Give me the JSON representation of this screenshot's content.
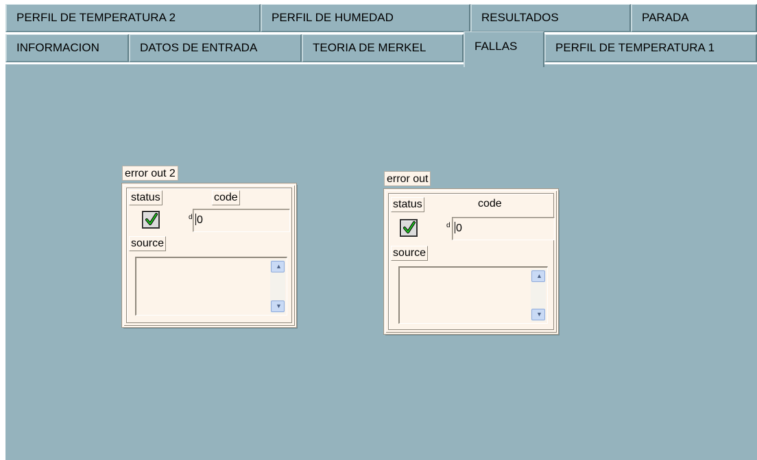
{
  "tabs": {
    "row1": [
      {
        "label": "PERFIL DE TEMPERATURA 2"
      },
      {
        "label": "PERFIL DE HUMEDAD"
      },
      {
        "label": "RESULTADOS"
      },
      {
        "label": "PARADA"
      }
    ],
    "row2": [
      {
        "label": "INFORMACION"
      },
      {
        "label": "DATOS DE ENTRADA"
      },
      {
        "label": "TEORIA DE MERKEL"
      },
      {
        "label": "FALLAS",
        "active": true
      },
      {
        "label": "PERFIL DE TEMPERATURA 1"
      }
    ]
  },
  "clusters": [
    {
      "title": "error out 2",
      "status_label": "status",
      "status_ok": true,
      "code_label": "code",
      "code_radix": "d",
      "code_value": "0",
      "source_label": "source",
      "source_value": ""
    },
    {
      "title": "error out",
      "status_label": "status",
      "status_ok": true,
      "code_label": "code",
      "code_radix": "d",
      "code_value": "0",
      "source_label": "source",
      "source_value": ""
    }
  ],
  "colors": {
    "panel": "#95b3bd",
    "cluster_bg": "#fdf4ea",
    "check": "#22cc22"
  },
  "icons": [
    "checkmark-icon",
    "scroll-up-icon",
    "scroll-down-icon"
  ]
}
